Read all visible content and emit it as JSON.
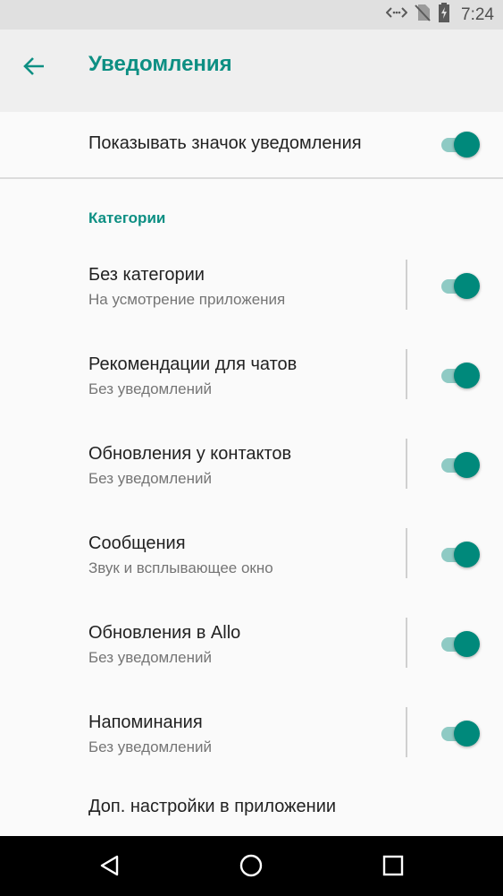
{
  "status_bar": {
    "time": "7:24",
    "icons": [
      "code-arrows-icon",
      "no-sim-icon",
      "battery-charging-icon"
    ]
  },
  "header": {
    "title": "Уведомления",
    "back_icon": "arrow-back-icon"
  },
  "top_setting": {
    "label": "Показывать значок уведомления",
    "enabled": true
  },
  "categories": {
    "header": "Категории",
    "items": [
      {
        "title": "Без категории",
        "subtitle": "На усмотрение приложения",
        "enabled": true
      },
      {
        "title": "Рекомендации для чатов",
        "subtitle": "Без уведомлений",
        "enabled": true
      },
      {
        "title": "Обновления у контактов",
        "subtitle": "Без уведомлений",
        "enabled": true
      },
      {
        "title": "Сообщения",
        "subtitle": "Звук и всплывающее окно",
        "enabled": true
      },
      {
        "title": "Обновления в Allo",
        "subtitle": "Без уведомлений",
        "enabled": true
      },
      {
        "title": "Напоминания",
        "subtitle": "Без уведомлений",
        "enabled": true
      }
    ]
  },
  "more_settings": {
    "label": "Доп. настройки в приложении"
  },
  "colors": {
    "accent": "#00897b",
    "accent_track": "#8fcac4",
    "title_teal": "#0d8f83"
  },
  "nav_bar": {
    "buttons": [
      "back-triangle-icon",
      "home-circle-icon",
      "recents-square-icon"
    ]
  }
}
